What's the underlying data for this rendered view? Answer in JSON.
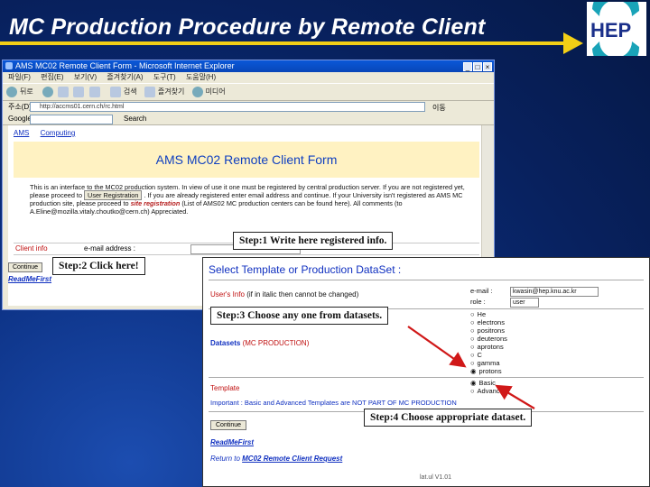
{
  "slide": {
    "title": "MC Production Procedure by Remote Client",
    "logo_text": "HEP"
  },
  "browser1": {
    "window_title": "AMS MC02 Remote Client Form - Microsoft Internet Explorer",
    "menu": [
      "파일(F)",
      "편집(E)",
      "보기(V)",
      "즐겨찾기(A)",
      "도구(T)",
      "도움말(H)"
    ],
    "toolbar_labels": [
      "뒤로",
      "검색",
      "즐겨찾기",
      "미디어"
    ],
    "address_label": "주소(D)",
    "address_value": "http://accms01.cern.ch/rc.html",
    "go_label": "이동",
    "links_label": "Google",
    "search_label": "Search",
    "nav_links": [
      "AMS",
      "Computing"
    ],
    "page_header": "AMS MC02 Remote Client Form",
    "intro": {
      "text_1": "This is an interface to the MC02 production system. In view of use it one must be registered by central production server. If you are not registered yet, please proceed to",
      "register_button": "User Registration",
      "text_2": ". If you are already registered enter email address and continue. If your University isn't registered as AMS MC production site, please proceed to",
      "site_link": "site registration",
      "text_3": "(List of AMS02 MC production centers can be found here). All comments (to A.Eline@mozilla.vitaly.choutko@cern.ch) Appreciated."
    },
    "client_info_label": "Client info",
    "email_label": "e-mail address :",
    "continue_button": "Continue",
    "readme_link": "ReadMeFirst"
  },
  "browser2": {
    "title": "Select  Template or Production DataSet :",
    "users_info_label": "User's Info",
    "users_info_note": "(if in italic then cannot be changed)",
    "email_label": "e-mail :",
    "email_value": "kwasin@hep.knu.ac.kr",
    "role_label": "role :",
    "role_value": "user",
    "datasets_label": "Datasets",
    "datasets_sub": "(MC PRODUCTION)",
    "datasets": [
      "He",
      "electrons",
      "positrons",
      "deuterons",
      "aprotons",
      "C",
      "gamma",
      "protons"
    ],
    "selected_dataset": "protons",
    "template_label": "Template",
    "templates": [
      "Basic",
      "Advanced"
    ],
    "selected_template": "Basic",
    "important_text": "Important : Basic and Advanced Templates are NOT PART OF MC PRODUCTION",
    "continue_button": "Continue",
    "readme_link": "ReadMeFirst",
    "return_prefix": "Return to",
    "return_link": "MC02 Remote Client Request",
    "footer": "lat.ul V1.01"
  },
  "steps": {
    "step1": "Step:1 Write here registered info.",
    "step2": "Step:2 Click here!",
    "step3": "Step:3 Choose any one from datasets.",
    "step4": "Step:4 Choose appropriate dataset."
  },
  "colors": {
    "slide_bg": "#0a2a6e",
    "arrow_yellow": "#f2cf16",
    "arrow_red": "#d01818",
    "link_blue": "#1030c0",
    "label_red": "#c01010"
  }
}
